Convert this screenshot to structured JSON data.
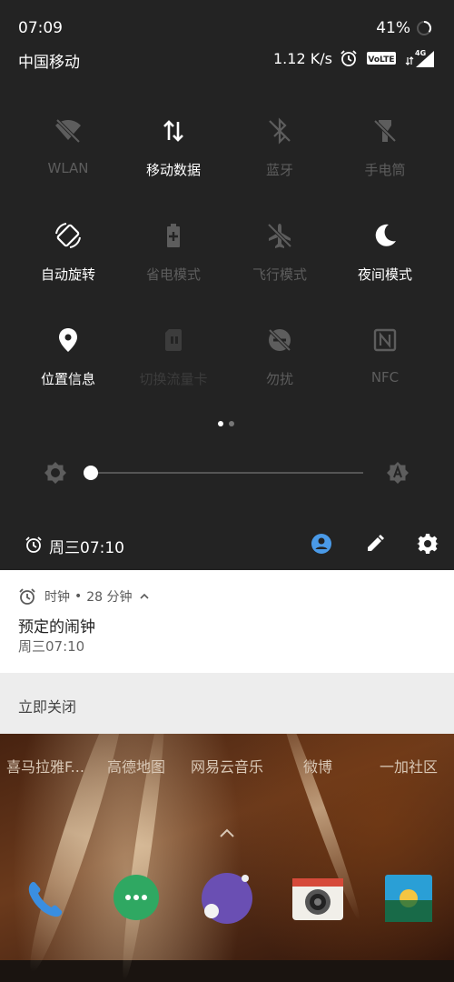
{
  "status_bar": {
    "time": "07:09",
    "battery": "41%",
    "carrier": "中国移动",
    "net_speed": "1.12 K/s",
    "volte_badge": "VoLTE",
    "network_type": "4G"
  },
  "quick_settings": {
    "tiles": [
      {
        "label": "WLAN",
        "icon": "wifi-off-icon",
        "state": "off"
      },
      {
        "label": "移动数据",
        "icon": "mobile-data-icon",
        "state": "on"
      },
      {
        "label": "蓝牙",
        "icon": "bluetooth-off-icon",
        "state": "off"
      },
      {
        "label": "手电筒",
        "icon": "flashlight-off-icon",
        "state": "off"
      },
      {
        "label": "自动旋转",
        "icon": "auto-rotate-icon",
        "state": "on"
      },
      {
        "label": "省电模式",
        "icon": "battery-saver-icon",
        "state": "off"
      },
      {
        "label": "飞行模式",
        "icon": "airplane-mode-icon",
        "state": "off"
      },
      {
        "label": "夜间模式",
        "icon": "night-mode-icon",
        "state": "on"
      },
      {
        "label": "位置信息",
        "icon": "location-icon",
        "state": "on"
      },
      {
        "label": "切换流量卡",
        "icon": "sim-switch-icon",
        "state": "disabled"
      },
      {
        "label": "勿扰",
        "icon": "do-not-disturb-icon",
        "state": "off"
      },
      {
        "label": "NFC",
        "icon": "nfc-icon",
        "state": "off"
      }
    ],
    "page_indicator": {
      "pages": 2,
      "current": 1
    },
    "brightness": {
      "level": 0.0,
      "auto_icon": "brightness-auto-icon",
      "low_icon": "brightness-low-icon"
    },
    "footer": {
      "next_alarm": "周三07:10",
      "icons": [
        "alarm-icon",
        "user-icon",
        "edit-icon",
        "settings-icon"
      ],
      "accent_color": "#4a9ae8"
    }
  },
  "notification": {
    "app_name": "时钟",
    "separator": "•",
    "time_ago": "28 分钟",
    "title": "预定的闹钟",
    "text": "周三07:10",
    "action": "立即关闭"
  },
  "home_screen": {
    "app_labels": [
      "喜马拉雅F...",
      "高德地图",
      "网易云音乐",
      "微博",
      "一加社区"
    ],
    "dock_icons": [
      "phone-icon",
      "messages-icon",
      "browser-icon",
      "camera-icon",
      "gallery-icon"
    ]
  },
  "colors": {
    "panel_bg": "#232323",
    "tile_on": "#ffffff",
    "tile_off": "#5d5d5d",
    "accent": "#4a9ae8"
  }
}
